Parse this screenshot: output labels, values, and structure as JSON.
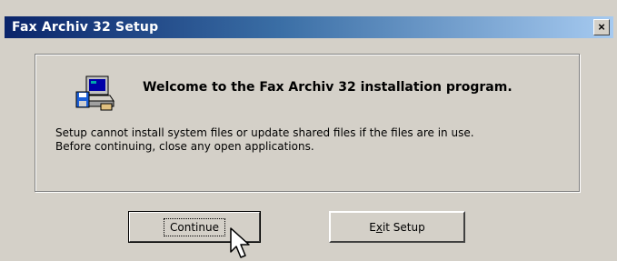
{
  "window": {
    "title": "Fax Archiv 32 Setup",
    "close_glyph": "×"
  },
  "group": {
    "heading": "Welcome to the Fax Archiv 32 installation program.",
    "icon": "setup-computer-icon",
    "message_lines": [
      "Setup cannot install system files or update shared files if the files are in use.",
      "Before continuing, close any open applications."
    ]
  },
  "buttons": {
    "continue_label": "Continue",
    "exit_prefix": "E",
    "exit_mnemonic": "x",
    "exit_suffix": "it Setup"
  },
  "colors": {
    "title_gradient_start": "#0a246a",
    "title_gradient_end": "#a6caf0",
    "face": "#d4d0c8"
  }
}
